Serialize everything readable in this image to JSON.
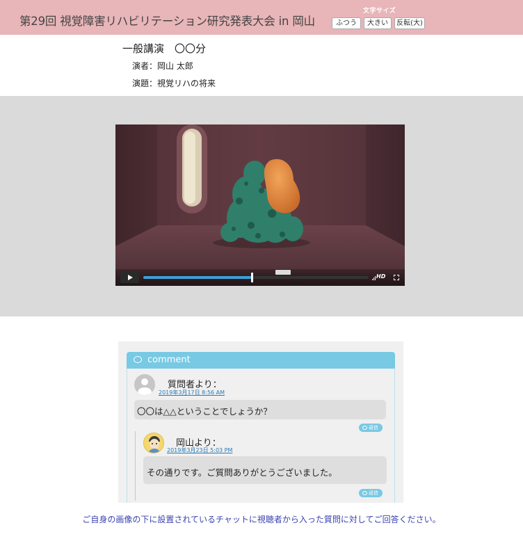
{
  "header": {
    "title": "第29回 視覚障害リハビリテーション研究発表大会 in 岡山",
    "font_size_label": "文字サイズ",
    "font_size_buttons": [
      "ふつう",
      "大きい",
      "反転(大)"
    ],
    "background_color": "#e8b5b8"
  },
  "lecture": {
    "type": "一般講演　〇〇分",
    "speaker": "演者：岡山 太郎",
    "title": "演題：視覚リハの将来"
  },
  "video": {
    "play_icon": "play-icon",
    "progress_fraction": 0.48,
    "quality_label": "HD",
    "accent_color": "#3aa1d6"
  },
  "comments": {
    "header_label": "comment",
    "header_icon": "speech-bubble-icon",
    "header_color": "#78c9e3",
    "items": [
      {
        "name": "質問者より：",
        "date": "2019年3月17日 8:56 AM",
        "text": "〇〇は△△ということでしょうか？",
        "reply_label": "返信"
      },
      {
        "name": "岡山より：",
        "date": "2019年3月23日 5:03 PM",
        "text": "その通りです。ご質問ありがとうございました。",
        "reply_label": "返信"
      }
    ]
  },
  "footer": {
    "note": "ご自身の画像の下に設置されているチャットに視聴者から入った質問に対してご回答ください。",
    "color": "#3a44b0"
  }
}
